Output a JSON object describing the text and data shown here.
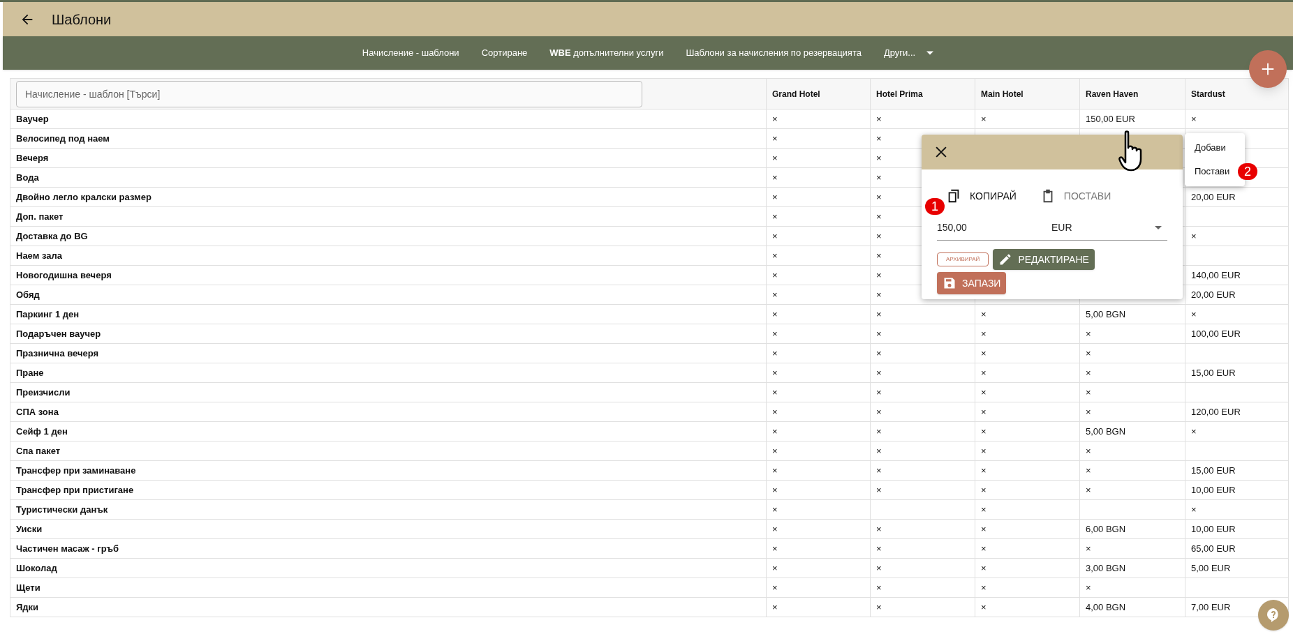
{
  "header": {
    "title": "Шаблони"
  },
  "nav": [
    {
      "label": "Начисление - шаблони",
      "kind": "link"
    },
    {
      "label": "Сортиране",
      "kind": "link"
    },
    {
      "label": "**WBE** допълнителни услуги",
      "kind": "link"
    },
    {
      "label": "Шаблони за начисления по резервацията",
      "kind": "link"
    },
    {
      "label": "Други...",
      "kind": "dropdown"
    }
  ],
  "search": {
    "placeholder": "Начисление - шаблон [Търси]"
  },
  "table": {
    "columns": [
      "Grand Hotel",
      "Hotel Prima",
      "Main Hotel",
      "Raven Haven",
      "Stardust"
    ],
    "rows": [
      {
        "name": "Ваучер",
        "cells": [
          "×",
          "×",
          "×",
          "150,00 EUR",
          "×"
        ]
      },
      {
        "name": "Велосипед под наем",
        "cells": [
          "×",
          "×",
          null,
          null,
          null
        ]
      },
      {
        "name": "Вечеря",
        "cells": [
          "×",
          "×",
          null,
          null,
          null
        ]
      },
      {
        "name": "Вода",
        "cells": [
          "×",
          "×",
          null,
          null,
          null
        ]
      },
      {
        "name": "Двойно легло кралски размер",
        "cells": [
          "×",
          "×",
          null,
          null,
          "20,00 EUR"
        ]
      },
      {
        "name": "Доп. пакет",
        "cells": [
          "×",
          "×",
          null,
          null,
          null
        ]
      },
      {
        "name": "Доставка до BG",
        "cells": [
          "×",
          "×",
          null,
          null,
          "×"
        ]
      },
      {
        "name": "Наем зала",
        "cells": [
          "×",
          "×",
          null,
          null,
          null
        ]
      },
      {
        "name": "Новогодишна вечеря",
        "cells": [
          "×",
          "×",
          null,
          null,
          "140,00 EUR"
        ]
      },
      {
        "name": "Обяд",
        "cells": [
          "×",
          "×",
          null,
          null,
          "20,00 EUR"
        ]
      },
      {
        "name": "Паркинг 1 ден",
        "cells": [
          "×",
          "×",
          "×",
          "5,00 BGN",
          "×"
        ]
      },
      {
        "name": "Подаръчен ваучер",
        "cells": [
          "×",
          "×",
          "×",
          "×",
          "100,00 EUR"
        ]
      },
      {
        "name": "Празнична вечеря",
        "cells": [
          "×",
          "×",
          "×",
          "×",
          null
        ]
      },
      {
        "name": "Пране",
        "cells": [
          "×",
          "×",
          "×",
          "×",
          "15,00 EUR"
        ]
      },
      {
        "name": "Преизчисли",
        "cells": [
          "×",
          "×",
          "×",
          "×",
          null
        ]
      },
      {
        "name": "СПА зона",
        "cells": [
          "×",
          "×",
          "×",
          "×",
          "120,00 EUR"
        ]
      },
      {
        "name": "Сейф 1 ден",
        "cells": [
          "×",
          "×",
          "×",
          "5,00 BGN",
          "×"
        ]
      },
      {
        "name": "Спа пакет",
        "cells": [
          "×",
          "×",
          "×",
          "×",
          null
        ]
      },
      {
        "name": "Трансфер при заминаване",
        "cells": [
          "×",
          "×",
          "×",
          "×",
          "15,00 EUR"
        ]
      },
      {
        "name": "Трансфер при пристигане",
        "cells": [
          "×",
          "×",
          "×",
          "×",
          "10,00 EUR"
        ]
      },
      {
        "name": "Туристически данък",
        "cells": [
          "×",
          null,
          "×",
          null,
          "×"
        ]
      },
      {
        "name": "Уиски",
        "cells": [
          "×",
          "×",
          "×",
          "6,00 BGN",
          "10,00 EUR"
        ]
      },
      {
        "name": "Частичен масаж - гръб",
        "cells": [
          "×",
          "×",
          "×",
          "×",
          "65,00 EUR"
        ]
      },
      {
        "name": "Шоколад",
        "cells": [
          "×",
          "×",
          "×",
          "3,00 BGN",
          "5,00 EUR"
        ]
      },
      {
        "name": "Щети",
        "cells": [
          "×",
          "×",
          "×",
          "×",
          null
        ]
      },
      {
        "name": "Ядки",
        "cells": [
          "×",
          "×",
          "×",
          "4,00 BGN",
          "7,00 EUR"
        ]
      }
    ]
  },
  "popup": {
    "copy": {
      "label": "КОПИРАЙ",
      "step": "1"
    },
    "paste": {
      "label": "ПОСТАВИ",
      "disabled": true
    },
    "amount": "150,00",
    "currency": "EUR",
    "archive": "АРХИВИРАЙ",
    "edit": "РЕДАКТИРАНЕ",
    "save": "ЗАПАЗИ"
  },
  "context_menu": [
    {
      "label": "Добави"
    },
    {
      "label": "Постави",
      "step": "2"
    }
  ]
}
